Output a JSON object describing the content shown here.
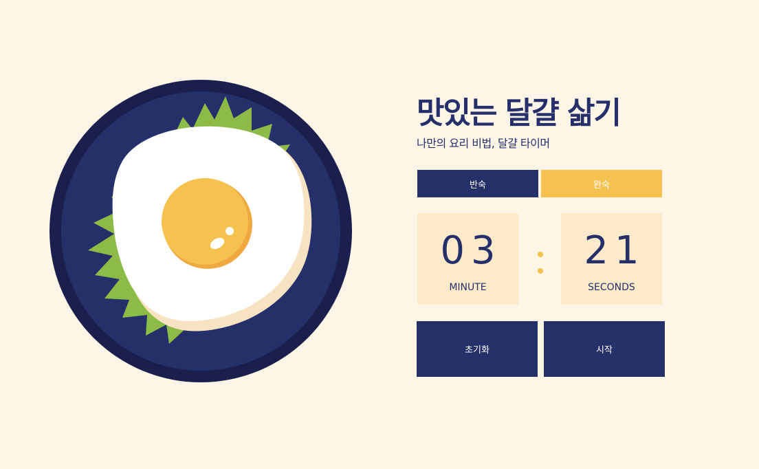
{
  "header": {
    "title": "맛있는 달걀 삶기",
    "subtitle": "나만의 요리 비법, 달걀 타이머"
  },
  "modes": {
    "half_label": "반숙",
    "full_label": "완숙"
  },
  "timer": {
    "minutes": "03",
    "minutes_unit": "MINUTE",
    "seconds": "21",
    "seconds_unit": "SECONDS"
  },
  "actions": {
    "reset_label": "초기화",
    "start_label": "시작"
  },
  "colors": {
    "background": "#fdf5e6",
    "navy": "#25306b",
    "plate_rim": "#1a1f4d",
    "yellow": "#f5c250",
    "timer_box": "#fdeaca",
    "lettuce": "#8dbb47"
  },
  "illustration": {
    "icon": "fried-egg-on-plate-icon"
  }
}
